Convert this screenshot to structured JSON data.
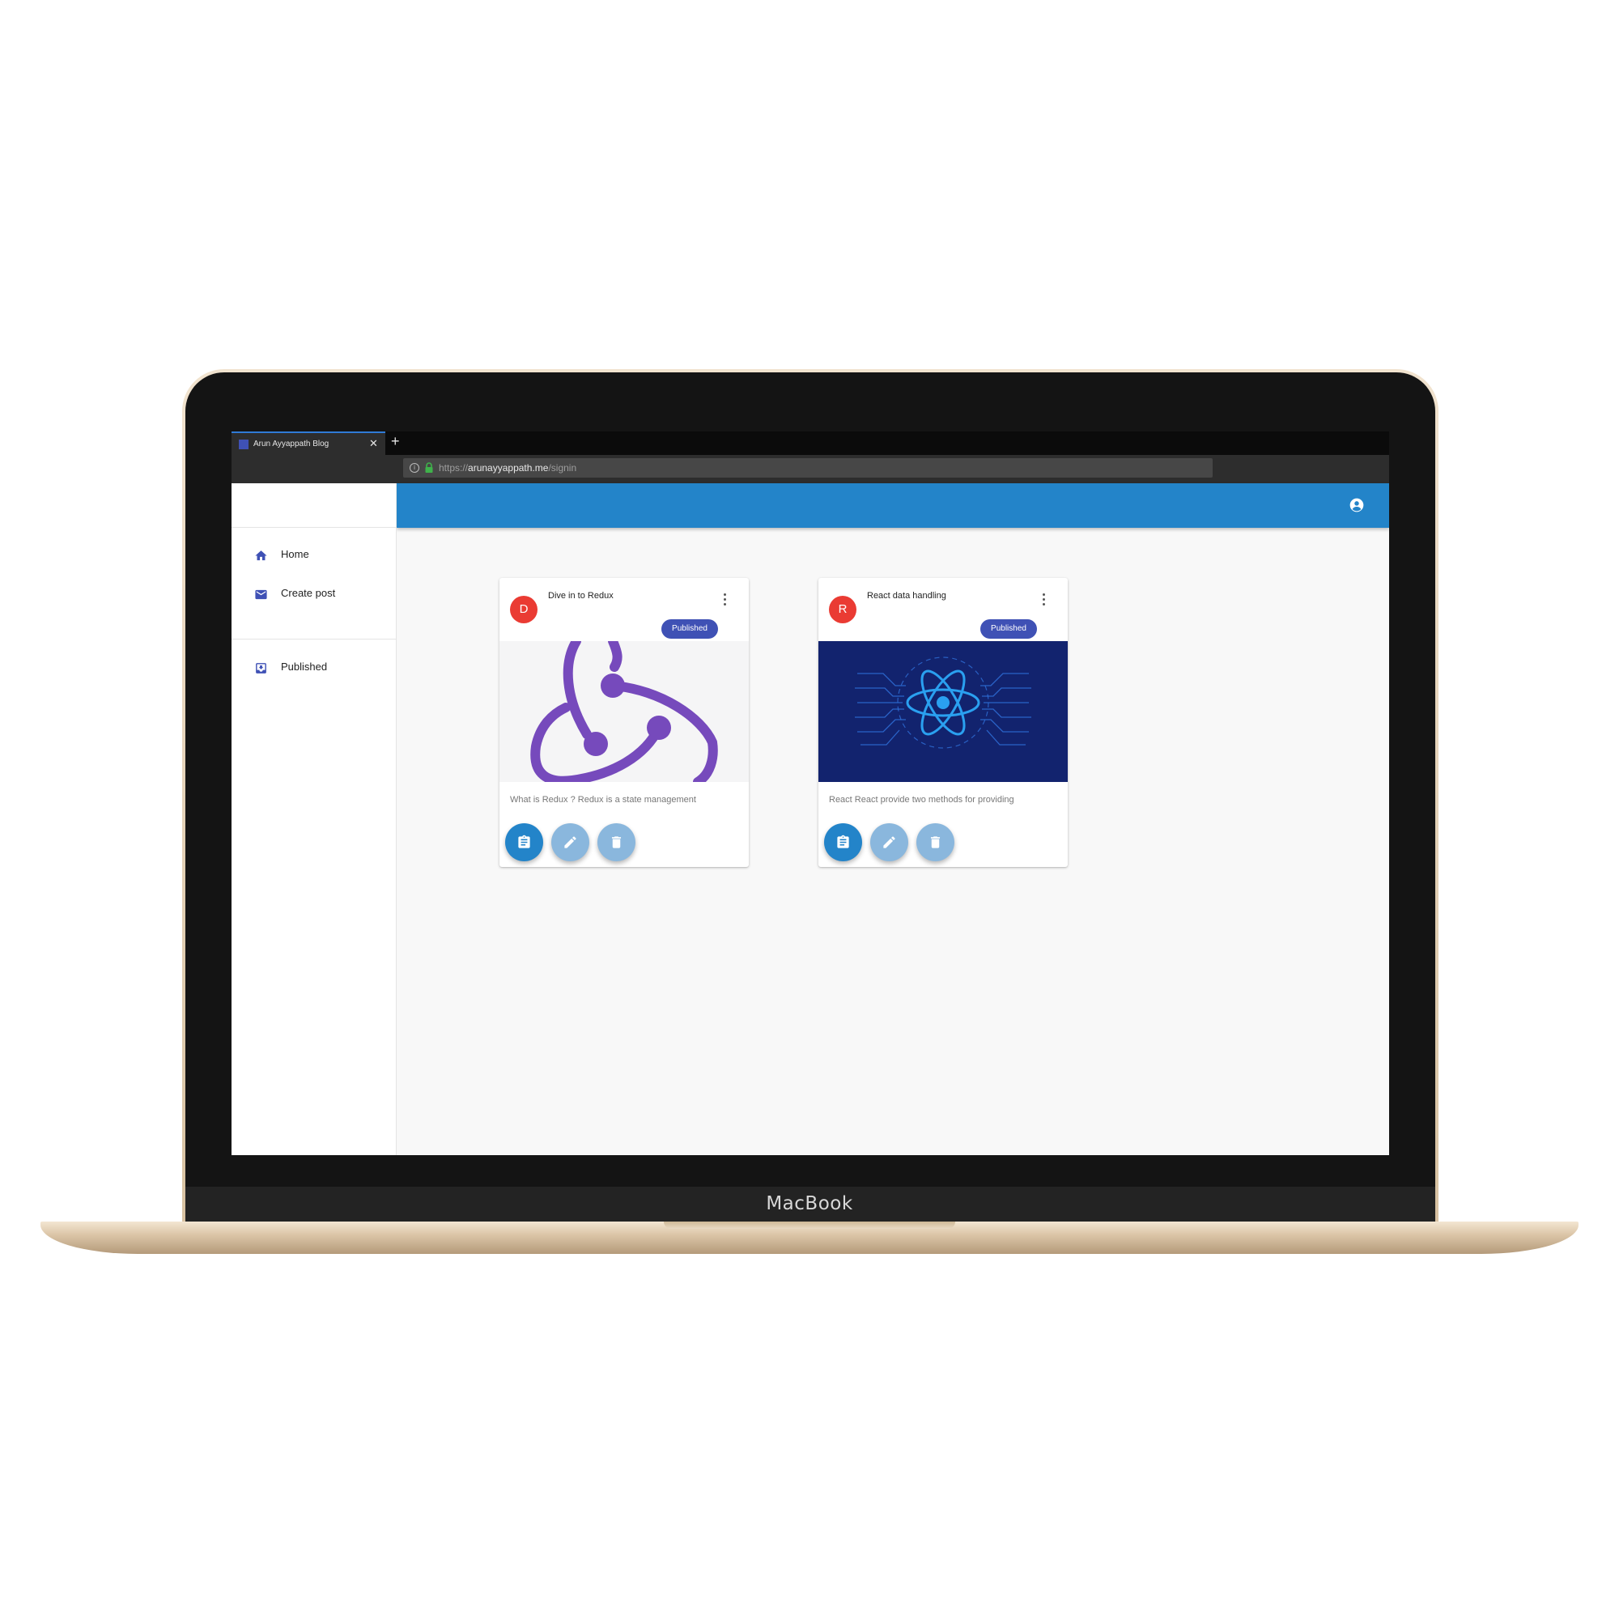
{
  "device": {
    "brand_label": "MacBook"
  },
  "browser": {
    "tab": {
      "title": "Arun Ayyappath Blog",
      "close_glyph": "✕"
    },
    "new_tab_glyph": "+",
    "url": {
      "scheme": "https://",
      "host": "arunayyappath.me",
      "path": "/signin"
    }
  },
  "appbar": {
    "color": "#2384c9",
    "account_icon": "account-circle-icon"
  },
  "sidebar": {
    "items": [
      {
        "label": "Home",
        "icon": "home-icon"
      },
      {
        "label": "Create post",
        "icon": "mail-icon"
      },
      {
        "label": "Published",
        "icon": "inbox-icon"
      }
    ]
  },
  "posts": [
    {
      "avatar_letter": "D",
      "title": "Dive in to Redux",
      "status": "Published",
      "image": "redux-logo",
      "excerpt": "What is Redux ? Redux is a state management"
    },
    {
      "avatar_letter": "R",
      "title": "React data handling",
      "status": "Published",
      "image": "react-context-illustration",
      "excerpt": "React React provide two methods for providing"
    }
  ],
  "card_actions": [
    "clipboard-icon",
    "pencil-icon",
    "trash-icon"
  ],
  "colors": {
    "accent": "#2384c9",
    "badge": "#3f51b5",
    "avatar": "#ea3b33",
    "nav_icon": "#3f51b5"
  }
}
